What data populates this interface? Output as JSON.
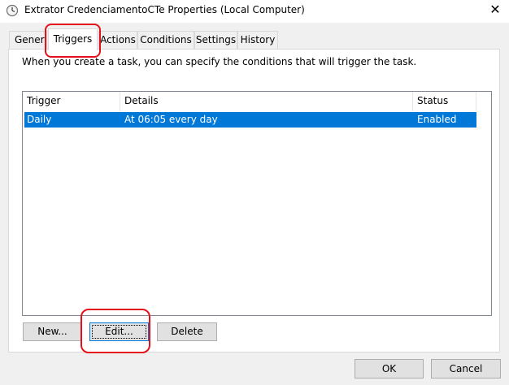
{
  "window": {
    "title": "Extrator CredenciamentoCTe Properties (Local Computer)",
    "app_icon": "clock-icon",
    "close_label": "✕"
  },
  "tabs": [
    {
      "label": "General",
      "active": false
    },
    {
      "label": "Triggers",
      "active": true
    },
    {
      "label": "Actions",
      "active": false
    },
    {
      "label": "Conditions",
      "active": false
    },
    {
      "label": "Settings",
      "active": false
    },
    {
      "label": "History",
      "active": false
    }
  ],
  "triggers_panel": {
    "instruction": "When you create a task, you can specify the conditions that will trigger the task.",
    "columns": [
      "Trigger",
      "Details",
      "Status"
    ],
    "rows": [
      {
        "trigger": "Daily",
        "details": "At 06:05 every day",
        "status": "Enabled",
        "selected": true
      }
    ],
    "buttons": {
      "new_label": "New...",
      "edit_label": "Edit...",
      "delete_label": "Delete"
    }
  },
  "dialog_buttons": {
    "ok_label": "OK",
    "cancel_label": "Cancel"
  },
  "colors": {
    "selection": "#0078d7",
    "annotation": "#e3111b"
  }
}
